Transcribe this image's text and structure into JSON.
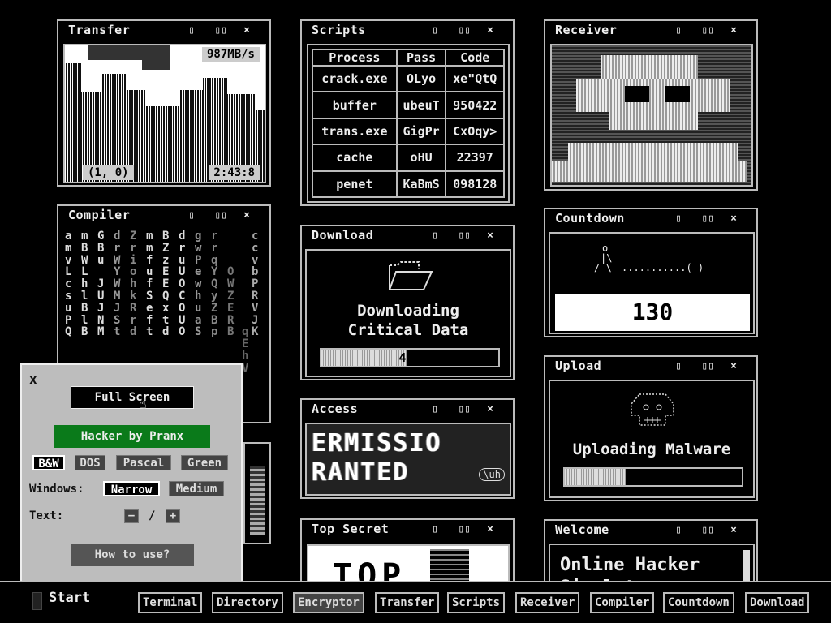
{
  "controls": {
    "min": "▯",
    "max": "▯▯",
    "close": "×"
  },
  "transfer": {
    "title": "Transfer",
    "speed": "987MB/s",
    "coords": "(1, 0)",
    "time": "2:43:8"
  },
  "scripts": {
    "title": "Scripts",
    "headers": [
      "Process",
      "Pass",
      "Code"
    ],
    "rows": [
      [
        "crack.exe",
        "OLyo",
        "xe\"QtQ"
      ],
      [
        "buffer",
        "ubeuT",
        "950422"
      ],
      [
        "trans.exe",
        "GigPr",
        "CxOqy>"
      ],
      [
        "cache",
        "oHU",
        "22397"
      ],
      [
        "penet",
        "KaBmS",
        "098128"
      ]
    ]
  },
  "receiver": {
    "title": "Receiver"
  },
  "compiler": {
    "title": "Compiler",
    "columns": [
      "a\nm\nv\nL\nc\ns\nu\nP\nQ",
      "m\nB\nW\nL\nh\nl\nB\nl\nB",
      "G\nB\nu\n\nJ\nU\nJ\nN\nM",
      "d\nr\nW\nY\nW\nM\nJ\nS\nt",
      "Z\nr\ni\no\nh\nk\nR\nr\nd",
      "m\nm\nf\nu\nf\nS\ne\nf\nt",
      "B\nZ\nz\nE\nE\nQ\nx\nt\nd",
      "d\nr\nu\nU\nO\nC\nO\nU\nO",
      "g\nw\nP\ne\nw\nh\nu\na\nS",
      "r\nr\nq\nY\nQ\ny\nZ\nB\np",
      "\n\n\nO\nW\nZ\nE\nR\nB",
      "c\nc\nv\nb\nP\nR\nV\nJ\nK",
      "\n\n\n\n\n\n\n\nq\nE\nh\nV"
    ]
  },
  "download": {
    "title": "Download",
    "line1": "Downloading",
    "line2": "Critical Data",
    "progress": 48,
    "progress_label": "48%"
  },
  "access": {
    "title": "Access",
    "line1": "ERMISSIO",
    "line2": "RANTED",
    "stamp": "\\uh"
  },
  "top_secret": {
    "title": "Top Secret",
    "text": "TOP"
  },
  "countdown": {
    "title": "Countdown",
    "value": "130",
    "art_line1": "o",
    "art_line2": "|\\",
    "art_line3": "/ \\",
    "rope": "...........(_)"
  },
  "upload": {
    "title": "Upload",
    "label": "Uploading Malware",
    "progress": 35,
    "progress_label": "35%"
  },
  "welcome": {
    "title": "Welcome",
    "line1": "Online Hacker",
    "line2": "Simulator"
  },
  "panel": {
    "close": "x",
    "full_screen": "Full Screen",
    "brand": "Hacker by Pranx",
    "themes": [
      "B&W",
      "DOS",
      "Pascal",
      "Green"
    ],
    "windows_label": "Windows:",
    "windows_opts": [
      "Narrow",
      "Medium"
    ],
    "text_label": "Text:",
    "text_minus": "−",
    "text_sep": "/",
    "text_plus": "+",
    "how_to": "How to use?"
  },
  "taskbar": {
    "start": "Start",
    "items": [
      "Terminal",
      "Directory",
      "Encryptor",
      "Transfer",
      "Scripts",
      "Receiver",
      "Compiler",
      "Countdown",
      "Download"
    ]
  }
}
